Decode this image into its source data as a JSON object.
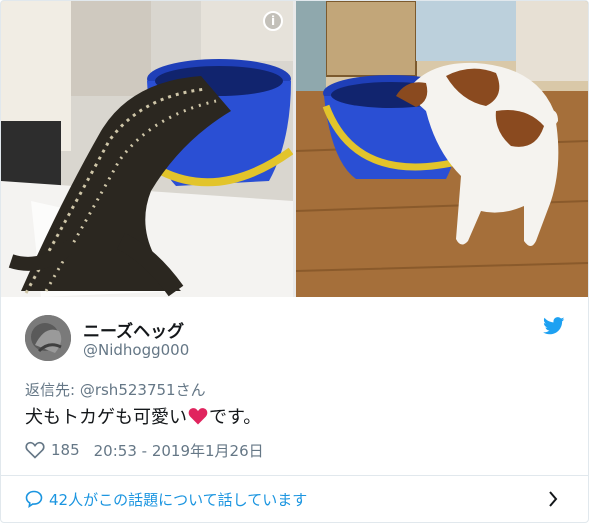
{
  "media": {
    "images": [
      {
        "subject": "monitor lizard drinking from blue bucket"
      },
      {
        "subject": "puppy drinking from blue bucket"
      }
    ],
    "info_icon_glyph": "i"
  },
  "author": {
    "display_name": "ニーズヘッグ",
    "handle": "@Nidhogg000"
  },
  "reply": {
    "prefix": "返信先: ",
    "mention": "@rsh523751",
    "suffix": "さん"
  },
  "tweet": {
    "text_before": "犬もトカゲも可愛い",
    "text_after": "です。"
  },
  "meta": {
    "likes": "185",
    "timestamp": "20:53 - 2019年1月26日"
  },
  "conversation": {
    "label": "42人がこの話題について話しています"
  },
  "colors": {
    "twitter_blue": "#1da1f2",
    "link_blue": "#1b95e0",
    "heart_red": "#e0245e",
    "muted": "#657786",
    "text": "#14171a"
  }
}
